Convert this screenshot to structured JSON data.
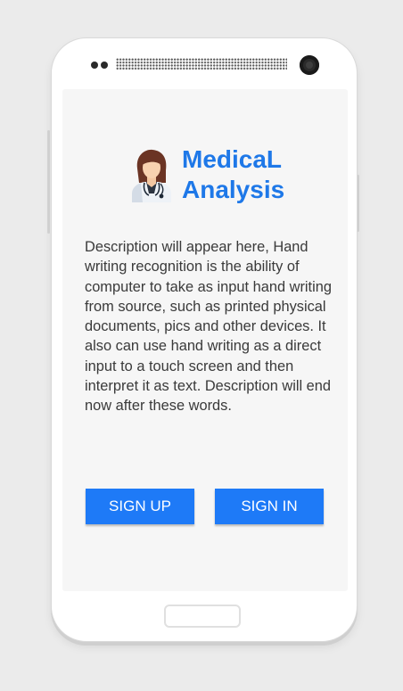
{
  "app": {
    "title_line1": "MedicaL",
    "title_line2": "Analysis",
    "logo_icon": "doctor-avatar-icon"
  },
  "description": "Description will appear here, Hand writing recognition is the ability of computer to take as input hand writing from source, such as printed physical documents, pics and other devices. It also can use hand writing as a direct input to a touch screen and then interpret it as text. Description will end now after these words.",
  "buttons": {
    "sign_up": "SIGN UP",
    "sign_in": "SIGN IN"
  },
  "colors": {
    "accent": "#1e78e8",
    "button": "#1e7af7",
    "background": "#ebebeb",
    "screen": "#f6f6f6"
  }
}
